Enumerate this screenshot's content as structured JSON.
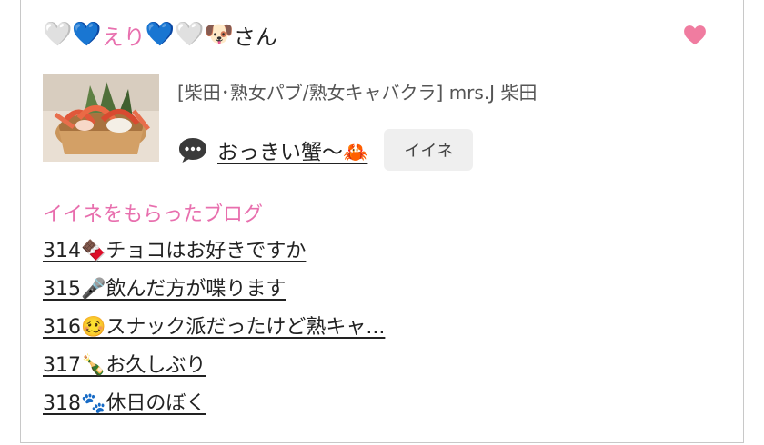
{
  "header": {
    "prefix_emoji": "🤍💙",
    "name": "えり",
    "suffix_emoji": "💙🤍🐶",
    "suffix_text": "さん"
  },
  "post": {
    "shop": "[柴田･熟女パブ/熟女キャバクラ]  mrs.J 柴田",
    "title": "おっきい蟹〜",
    "title_emoji": "🦀",
    "like_button": "イイネ"
  },
  "liked_section": {
    "title": "イイネをもらったブログ",
    "items": [
      {
        "num": "314",
        "emoji": "🍫",
        "text": "チョコはお好きですか"
      },
      {
        "num": "315",
        "emoji": "🎤",
        "text": "飲んだ方が喋ります"
      },
      {
        "num": "316",
        "emoji": "🥴",
        "text": "スナック派だったけど熟キャ..."
      },
      {
        "num": "317",
        "emoji": "🍾",
        "text": "お久しぶり"
      },
      {
        "num": "318",
        "emoji": "🐾",
        "text": "休日のぼく"
      }
    ]
  },
  "colors": {
    "accent_pink": "#e86fae",
    "heart": "#f07ca0",
    "like_button_bg": "#efefef"
  },
  "icons": {
    "heart": "heart-icon",
    "comment": "speech-bubble-icon"
  }
}
